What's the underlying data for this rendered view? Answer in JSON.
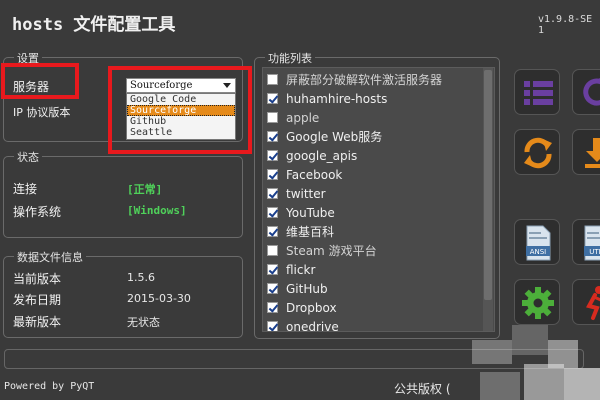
{
  "app": {
    "title": "hosts 文件配置工具",
    "version": "v1.9.8-SE 1"
  },
  "settings": {
    "title": "设置",
    "server_label": "服务器",
    "ip_label": "IP 协议版本",
    "server_selected": "Sourceforge",
    "server_options": [
      "Google Code",
      "Sourceforge",
      "Github",
      "Seattle"
    ]
  },
  "status": {
    "title": "状态",
    "connection_label": "连接",
    "connection_value": "[正常]",
    "os_label": "操作系统",
    "os_value": "[Windows]"
  },
  "datafile": {
    "title": "数据文件信息",
    "current_label": "当前版本",
    "current_value": "1.5.6",
    "date_label": "发布日期",
    "date_value": "2015-03-30",
    "latest_label": "最新版本",
    "latest_value": "无状态"
  },
  "features": {
    "title": "功能列表",
    "items": [
      {
        "label": "屏蔽部分破解软件激活服务器",
        "checked": false
      },
      {
        "label": "huhamhire-hosts",
        "checked": true
      },
      {
        "label": "apple",
        "checked": false
      },
      {
        "label": "Google Web服务",
        "checked": true
      },
      {
        "label": "google_apis",
        "checked": true
      },
      {
        "label": "Facebook",
        "checked": true
      },
      {
        "label": "twitter",
        "checked": true
      },
      {
        "label": "YouTube",
        "checked": true
      },
      {
        "label": "维基百科",
        "checked": true
      },
      {
        "label": "Steam 游戏平台",
        "checked": false
      },
      {
        "label": "flickr",
        "checked": true
      },
      {
        "label": "GitHub",
        "checked": true
      },
      {
        "label": "Dropbox",
        "checked": true
      },
      {
        "label": "onedrive",
        "checked": true
      }
    ]
  },
  "tools": {
    "badge_ansi": "ANSI",
    "badge_utf": "UTF"
  },
  "footer": {
    "powered_by": "Powered by PyQT",
    "license": "公共版权 ("
  },
  "colors": {
    "accent_purple": "#6a3fa0",
    "accent_orange": "#e58a1a",
    "accent_green": "#4caf3a",
    "accent_red": "#d62b1f"
  }
}
